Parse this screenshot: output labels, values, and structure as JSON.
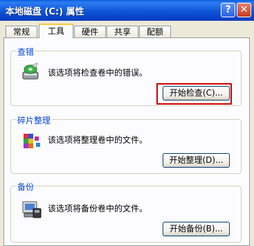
{
  "window": {
    "title": "本地磁盘 (C:) 属性",
    "help_icon": "help-icon",
    "close_icon": "close-icon"
  },
  "tabs": [
    {
      "label": "常规",
      "active": false
    },
    {
      "label": "工具",
      "active": true
    },
    {
      "label": "硬件",
      "active": false
    },
    {
      "label": "共享",
      "active": false
    },
    {
      "label": "配额",
      "active": false
    }
  ],
  "groups": {
    "check": {
      "title": "查错",
      "description": "该选项将检查卷中的错误。",
      "button": "开始检查(C)...",
      "icon": "disk-check-icon"
    },
    "defrag": {
      "title": "碎片整理",
      "description": "该选项将整理卷中的文件。",
      "button": "开始整理(D)...",
      "icon": "defrag-icon"
    },
    "backup": {
      "title": "备份",
      "description": "该选项将备份卷中的文件。",
      "button": "开始备份(B)...",
      "icon": "backup-icon"
    }
  },
  "colors": {
    "titlebar": "#0a55d8",
    "group_title": "#0046d5",
    "highlight": "#d00000"
  }
}
